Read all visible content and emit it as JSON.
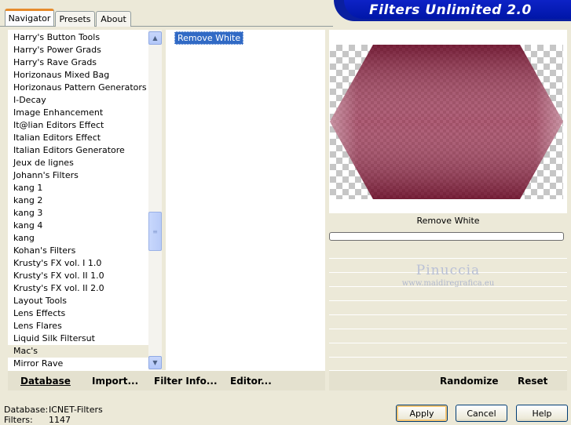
{
  "app": {
    "title": "Filters Unlimited 2.0"
  },
  "tabs": [
    {
      "label": "Navigator",
      "active": true
    },
    {
      "label": "Presets",
      "active": false
    },
    {
      "label": "About",
      "active": false
    }
  ],
  "categories": {
    "items": [
      "Harry's Button Tools",
      "Harry's Power Grads",
      "Harry's Rave Grads",
      "Horizonaus Mixed Bag",
      "Horizonaus Pattern Generators",
      "I-Decay",
      "Image Enhancement",
      "It@lian Editors Effect",
      "Italian Editors Effect",
      "Italian Editors Generatore",
      "Jeux de lignes",
      "Johann's Filters",
      "kang 1",
      "kang 2",
      "kang 3",
      "kang 4",
      "kang",
      "Kohan's Filters",
      "Krusty's FX vol. I 1.0",
      "Krusty's FX vol. II 1.0",
      "Krusty's FX vol. II 2.0",
      "Layout Tools",
      "Lens Effects",
      "Lens Flares",
      "Liquid Silk Filtersut",
      "Mac's",
      "Mirror Rave"
    ],
    "selected": "Mac's"
  },
  "filters": {
    "items": [
      "Remove White"
    ],
    "selected": "Remove White"
  },
  "preview": {
    "filter_name": "Remove White",
    "progress": 0,
    "shape_color": "#8b2a46"
  },
  "watermark": {
    "name": "Pinuccia",
    "url": "www.maidiregrafica.eu"
  },
  "left_bar": {
    "database": "Database",
    "import": "Import...",
    "filter_info": "Filter Info...",
    "editor": "Editor..."
  },
  "right_bar": {
    "randomize": "Randomize",
    "reset": "Reset"
  },
  "status": {
    "database_label": "Database:",
    "database_value": "ICNET-Filters",
    "filters_label": "Filters:",
    "filters_value": "1147"
  },
  "buttons": {
    "apply": "Apply",
    "cancel": "Cancel",
    "help": "Help"
  },
  "colors": {
    "banner": "#0016a8",
    "selection": "#316ac5",
    "window_bg": "#ece9d8"
  }
}
